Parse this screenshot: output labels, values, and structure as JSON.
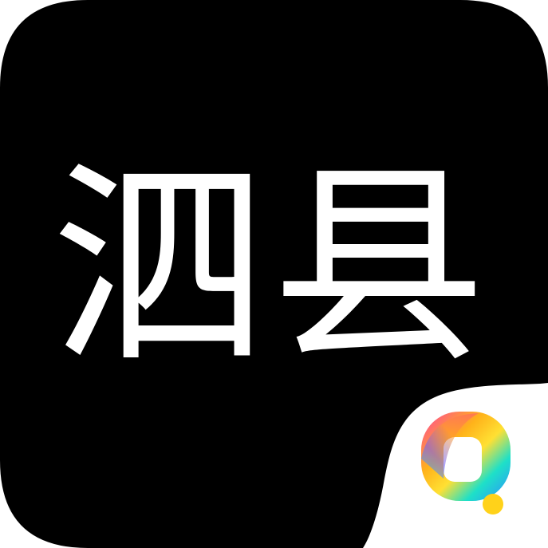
{
  "icon": {
    "title": "泗县",
    "background_color": "#000000",
    "text_color": "#ffffff",
    "badge_icon": "q-logo-icon",
    "badge_colors": [
      "#ff3ea5",
      "#ffb21a",
      "#ffe033",
      "#1ee0c8",
      "#2f8cff",
      "#8a4dff"
    ]
  }
}
